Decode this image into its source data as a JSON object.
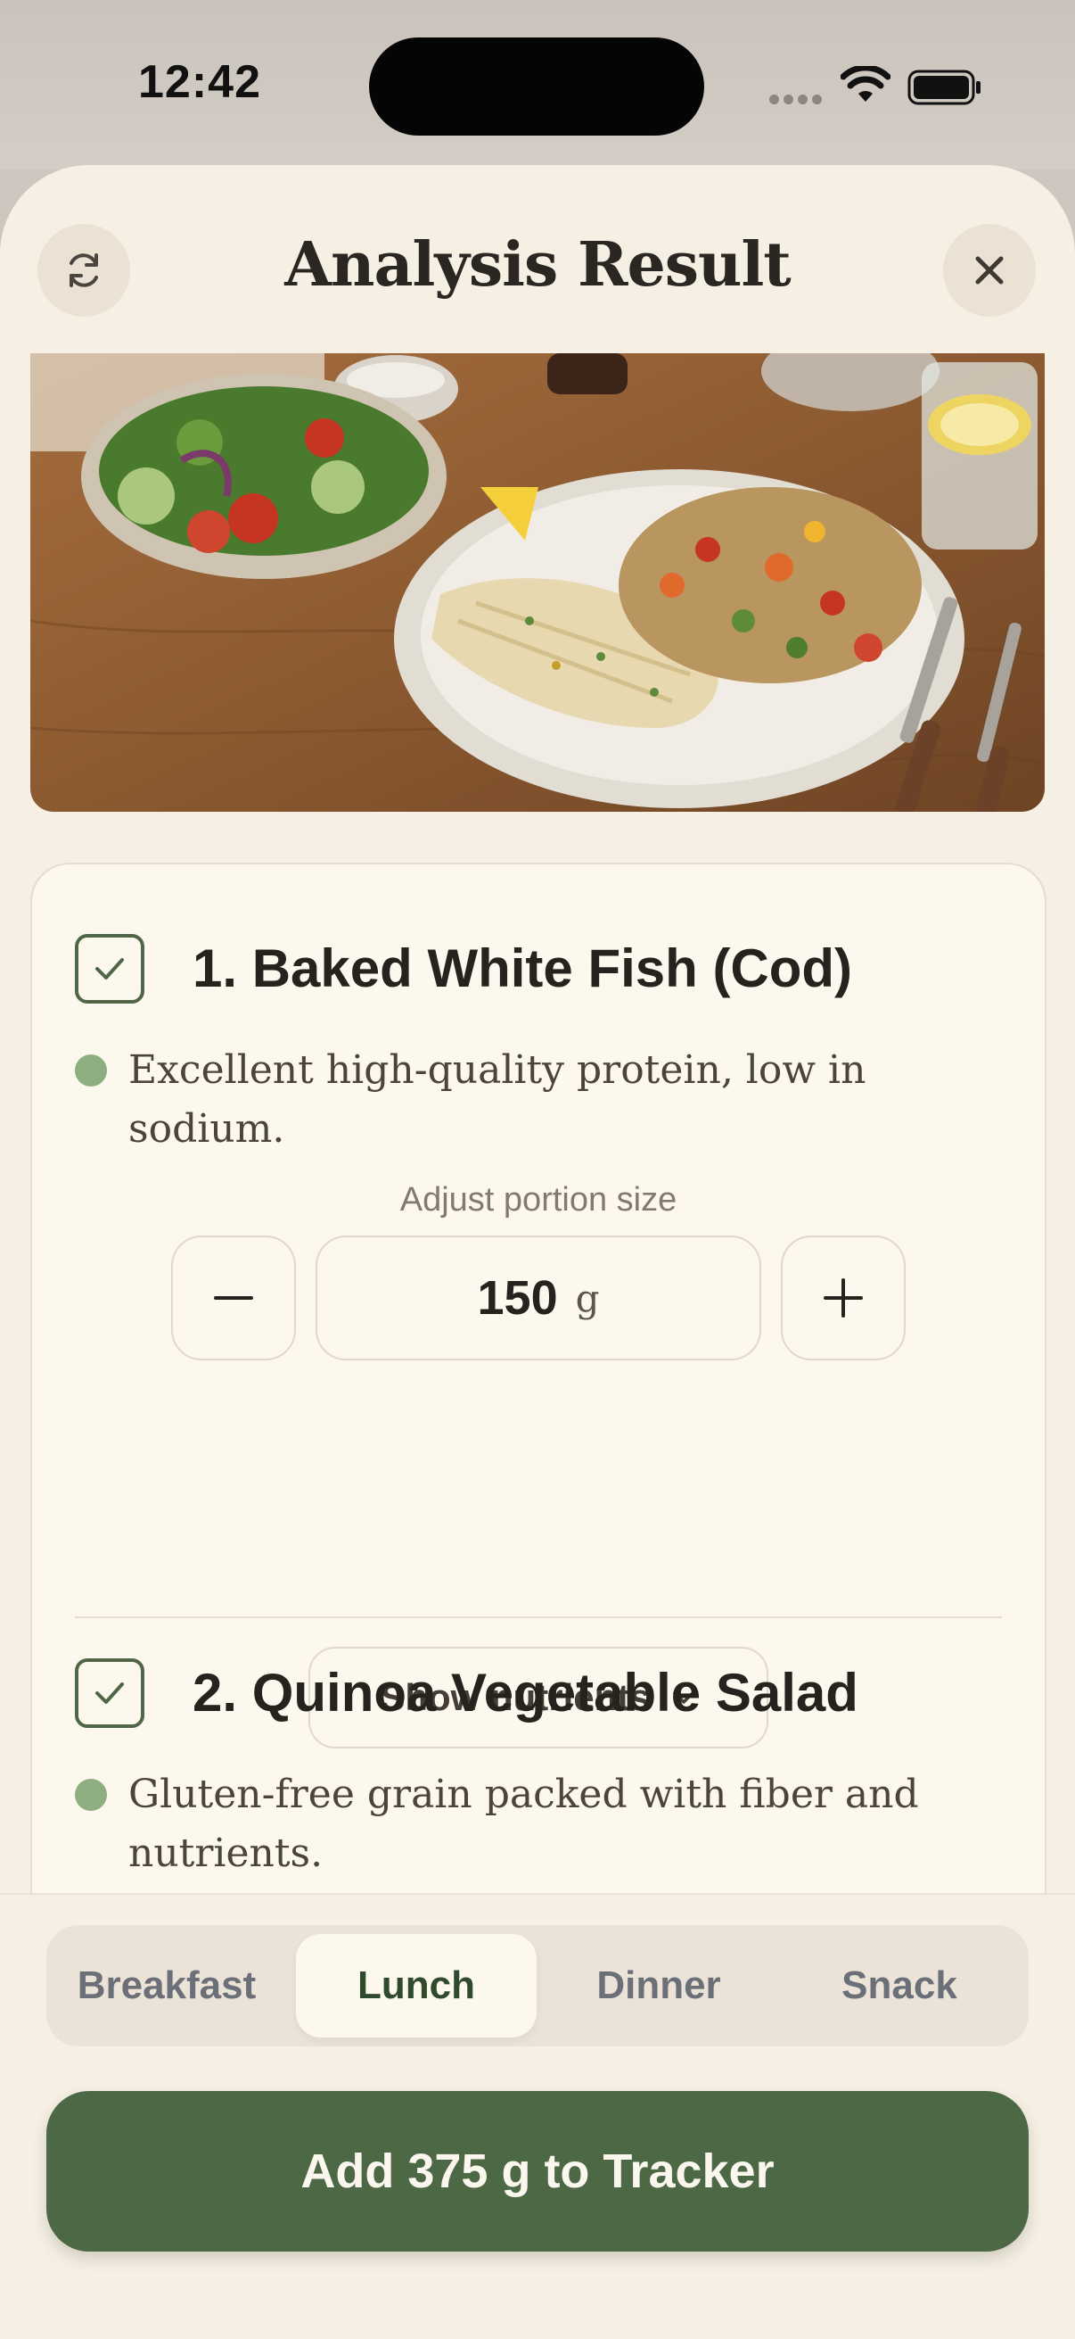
{
  "status_bar": {
    "time": "12:42"
  },
  "header": {
    "title": "Analysis Result"
  },
  "foods": [
    {
      "name": "1. Baked White Fish (Cod)",
      "checked": true,
      "note": "Excellent high-quality protein, low in sodium.",
      "portion_label": "Adjust portion size",
      "portion_value": "150",
      "portion_unit": "g",
      "nutrients_label": "Show nutrients"
    },
    {
      "name": "2. Quinoa Vegetable Salad",
      "checked": true,
      "note": "Gluten-free grain packed with fiber and nutrients."
    }
  ],
  "meal_tabs": [
    "Breakfast",
    "Lunch",
    "Dinner",
    "Snack"
  ],
  "selected_meal": "Lunch",
  "add_button": {
    "label": "Add 375 g to Tracker"
  },
  "colors": {
    "accent": "#4d6844",
    "background": "#f6efe4",
    "card": "#fdf8ee",
    "dot": "#8fae80"
  }
}
